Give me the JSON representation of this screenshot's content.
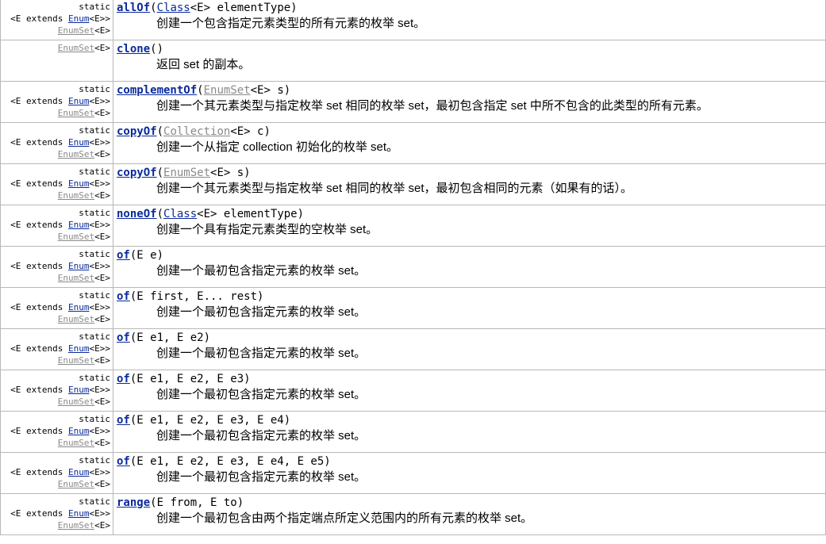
{
  "modifiers": {
    "static": "static",
    "generic_prefix": "<E extends ",
    "enum_link": "Enum",
    "generic_mid": "<E>>",
    "return_type_link": "EnumSet",
    "return_type_suffix": "<E>"
  },
  "methods": [
    {
      "name": "allOf",
      "static": true,
      "params": [
        {
          "text": "("
        },
        {
          "text": "Class",
          "link": true,
          "gray": false
        },
        {
          "text": "<E> elementType)"
        }
      ],
      "description": "创建一个包含指定元素类型的所有元素的枚举 set。"
    },
    {
      "name": "clone",
      "static": false,
      "params": [
        {
          "text": "()"
        }
      ],
      "description": "返回 set 的副本。"
    },
    {
      "name": "complementOf",
      "static": true,
      "params": [
        {
          "text": "("
        },
        {
          "text": "EnumSet",
          "link": true,
          "gray": true
        },
        {
          "text": "<E> s)"
        }
      ],
      "description": "创建一个其元素类型与指定枚举 set 相同的枚举 set，最初包含指定 set 中所不包含的此类型的所有元素。"
    },
    {
      "name": "copyOf",
      "static": true,
      "params": [
        {
          "text": "("
        },
        {
          "text": "Collection",
          "link": true,
          "gray": true
        },
        {
          "text": "<E> c)"
        }
      ],
      "description": "创建一个从指定 collection 初始化的枚举 set。"
    },
    {
      "name": "copyOf",
      "static": true,
      "params": [
        {
          "text": "("
        },
        {
          "text": "EnumSet",
          "link": true,
          "gray": true
        },
        {
          "text": "<E> s)"
        }
      ],
      "description": "创建一个其元素类型与指定枚举 set 相同的枚举 set，最初包含相同的元素（如果有的话）。"
    },
    {
      "name": "noneOf",
      "static": true,
      "params": [
        {
          "text": "("
        },
        {
          "text": "Class",
          "link": true,
          "gray": false
        },
        {
          "text": "<E> elementType)"
        }
      ],
      "description": "创建一个具有指定元素类型的空枚举 set。"
    },
    {
      "name": "of",
      "static": true,
      "params": [
        {
          "text": "(E e)"
        }
      ],
      "description": "创建一个最初包含指定元素的枚举 set。"
    },
    {
      "name": "of",
      "static": true,
      "params": [
        {
          "text": "(E first, E... rest)"
        }
      ],
      "description": "创建一个最初包含指定元素的枚举 set。"
    },
    {
      "name": "of",
      "static": true,
      "params": [
        {
          "text": "(E e1, E e2)"
        }
      ],
      "description": "创建一个最初包含指定元素的枚举 set。"
    },
    {
      "name": "of",
      "static": true,
      "params": [
        {
          "text": "(E e1, E e2, E e3)"
        }
      ],
      "description": "创建一个最初包含指定元素的枚举 set。"
    },
    {
      "name": "of",
      "static": true,
      "params": [
        {
          "text": "(E e1, E e2, E e3, E e4)"
        }
      ],
      "description": "创建一个最初包含指定元素的枚举 set。"
    },
    {
      "name": "of",
      "static": true,
      "params": [
        {
          "text": "(E e1, E e2, E e3, E e4, E e5)"
        }
      ],
      "description": "创建一个最初包含指定元素的枚举 set。"
    },
    {
      "name": "range",
      "static": true,
      "params": [
        {
          "text": "(E from, E to)"
        }
      ],
      "description": "创建一个最初包含由两个指定端点所定义范围内的所有元素的枚举 set。"
    }
  ]
}
